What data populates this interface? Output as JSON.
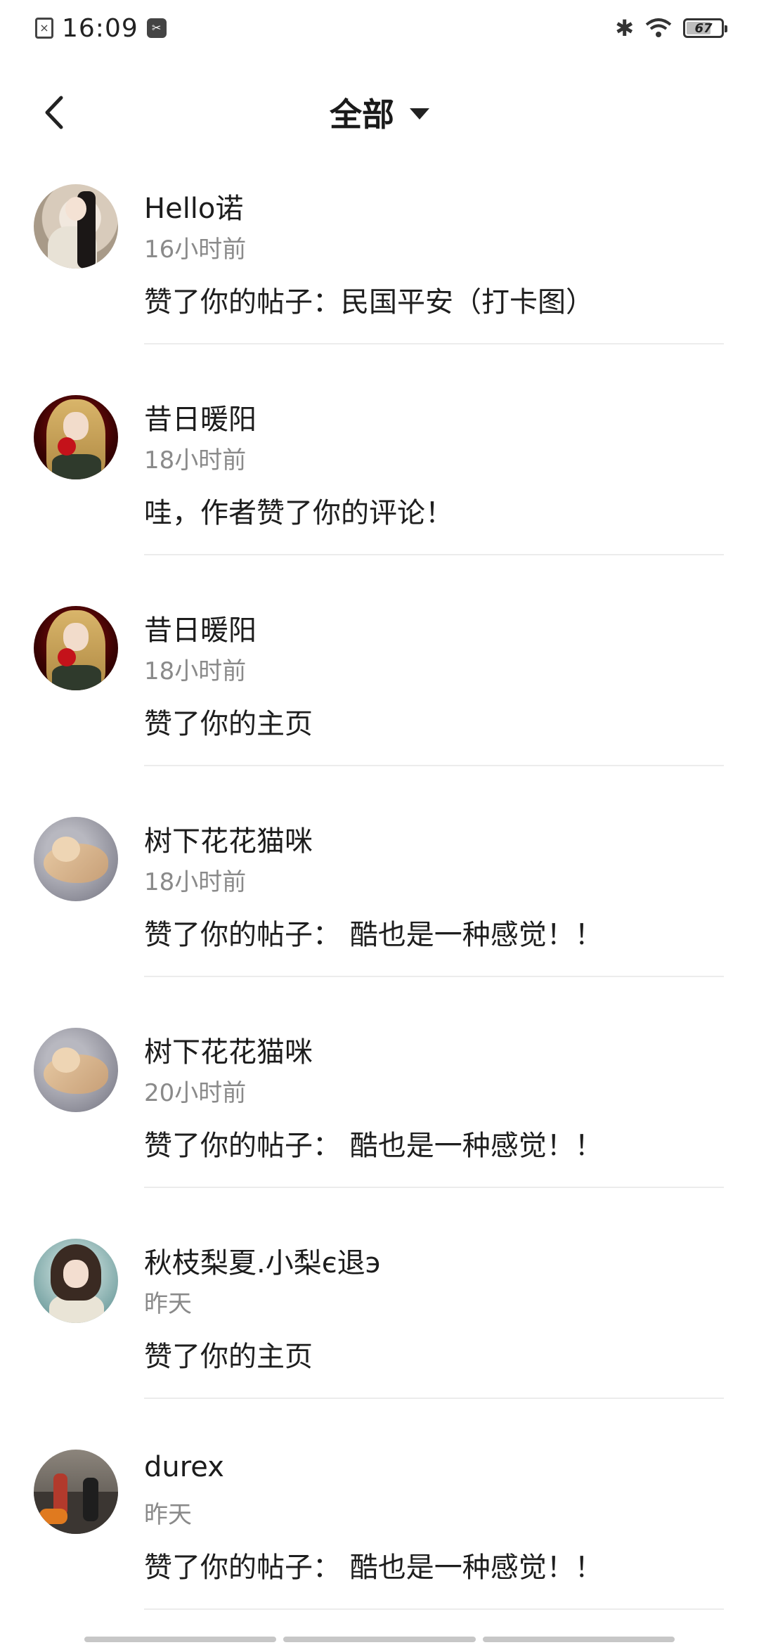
{
  "status_bar": {
    "time": "16:09",
    "battery": "67"
  },
  "header": {
    "title": "全部"
  },
  "notifications": [
    {
      "name": "Hello诺",
      "time": "16小时前",
      "content": "赞了你的帖子：民国平安（打卡图）"
    },
    {
      "name": "昔日暖阳",
      "time": "18小时前",
      "content": "哇，作者赞了你的评论！"
    },
    {
      "name": "昔日暖阳",
      "time": "18小时前",
      "content": "赞了你的主页"
    },
    {
      "name": "树下花花猫咪",
      "time": "18小时前",
      "content": "赞了你的帖子： 酷也是一种感觉！！"
    },
    {
      "name": "树下花花猫咪",
      "time": "20小时前",
      "content": "赞了你的帖子： 酷也是一种感觉！！"
    },
    {
      "name": "秋枝梨夏.小梨є退э",
      "time": "昨天",
      "content": "赞了你的主页"
    },
    {
      "name": "durex",
      "time": "昨天",
      "content": "赞了你的帖子： 酷也是一种感觉！！"
    }
  ]
}
